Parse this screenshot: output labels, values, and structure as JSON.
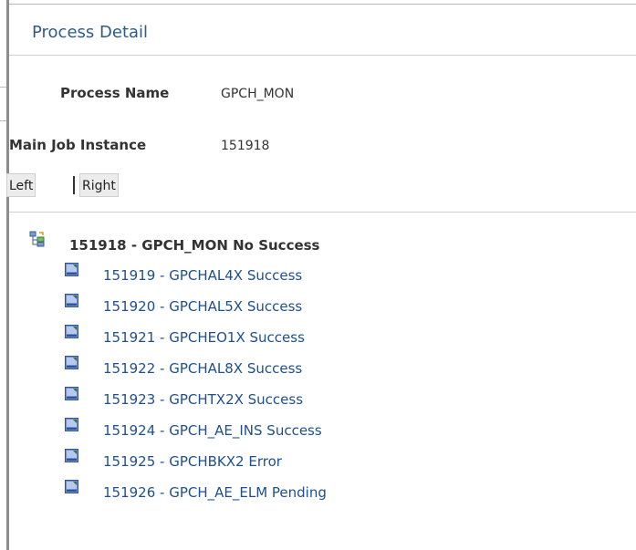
{
  "page": {
    "title": "Process Detail"
  },
  "fields": {
    "process_name_label": "Process Name",
    "process_name_value": "GPCH_MON",
    "main_job_label": "Main Job Instance",
    "main_job_value": "151918"
  },
  "buttons": {
    "left": "Left",
    "right": "Right"
  },
  "tree": {
    "root": {
      "label": "151918 - GPCH_MON No Success",
      "icon": "job-tree-icon"
    },
    "items": [
      {
        "label": "151919 - GPCHAL4X Success",
        "icon": "process-icon"
      },
      {
        "label": "151920 - GPCHAL5X Success",
        "icon": "process-icon"
      },
      {
        "label": "151921 - GPCHEO1X Success",
        "icon": "process-icon"
      },
      {
        "label": "151922 - GPCHAL8X Success",
        "icon": "process-icon"
      },
      {
        "label": "151923 - GPCHTX2X Success",
        "icon": "process-icon"
      },
      {
        "label": "151924 - GPCH_AE_INS Success",
        "icon": "process-icon"
      },
      {
        "label": "151925 - GPCHBKX2 Error",
        "icon": "process-icon"
      },
      {
        "label": "151926 - GPCH_AE_ELM Pending",
        "icon": "process-icon"
      }
    ]
  },
  "colors": {
    "title": "#2e5c8a",
    "link": "#1e4f91",
    "label": "#333333"
  }
}
